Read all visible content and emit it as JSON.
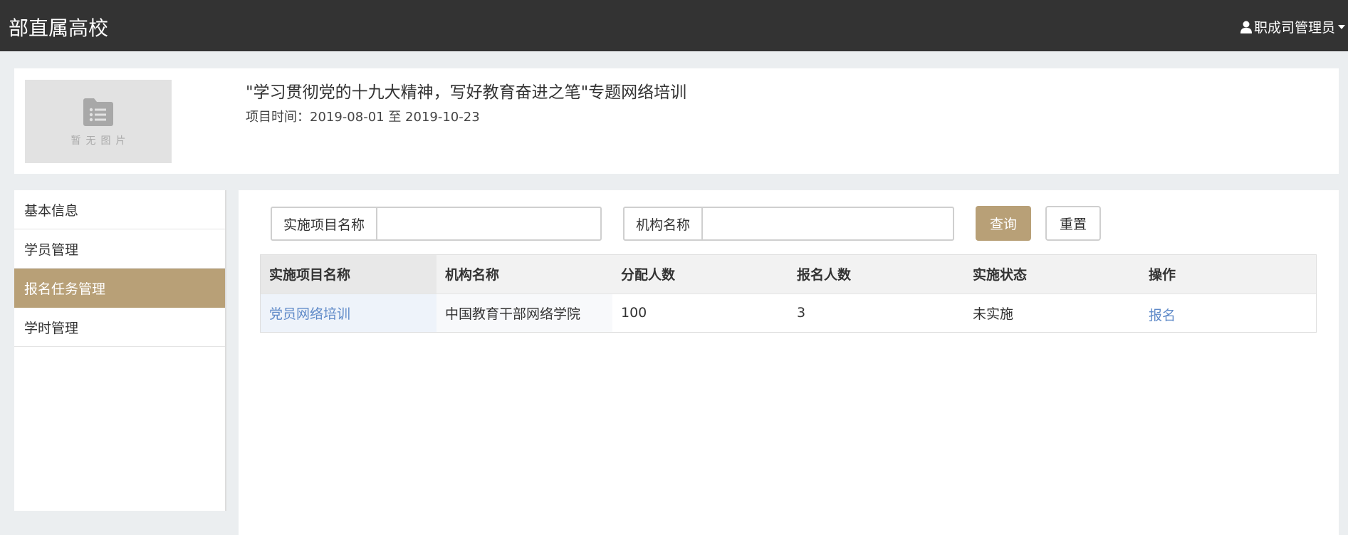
{
  "header": {
    "brand": "部直属高校",
    "user_name": "职成司管理员"
  },
  "project": {
    "no_image_text": "暂无图片",
    "title": "\"学习贯彻党的十九大精神，写好教育奋进之笔\"专题网络培训",
    "time": "项目时间：2019-08-01 至 2019-10-23"
  },
  "sidebar": {
    "items": [
      {
        "label": "基本信息"
      },
      {
        "label": "学员管理"
      },
      {
        "label": "报名任务管理"
      },
      {
        "label": "学时管理"
      }
    ]
  },
  "search": {
    "project_label": "实施项目名称",
    "project_value": "",
    "org_label": "机构名称",
    "org_value": "",
    "query_label": "查询",
    "reset_label": "重置"
  },
  "table": {
    "headers": [
      "实施项目名称",
      "机构名称",
      "分配人数",
      "报名人数",
      "实施状态",
      "操作"
    ],
    "rows": [
      {
        "project": "党员网络培训",
        "org": "中国教育干部网络学院",
        "allocated": "100",
        "enrolled": "3",
        "status": "未实施",
        "action": "报名"
      }
    ]
  },
  "colors": {
    "topbar": "#333333",
    "accent": "#b8a077",
    "link": "#5f8ac8"
  }
}
